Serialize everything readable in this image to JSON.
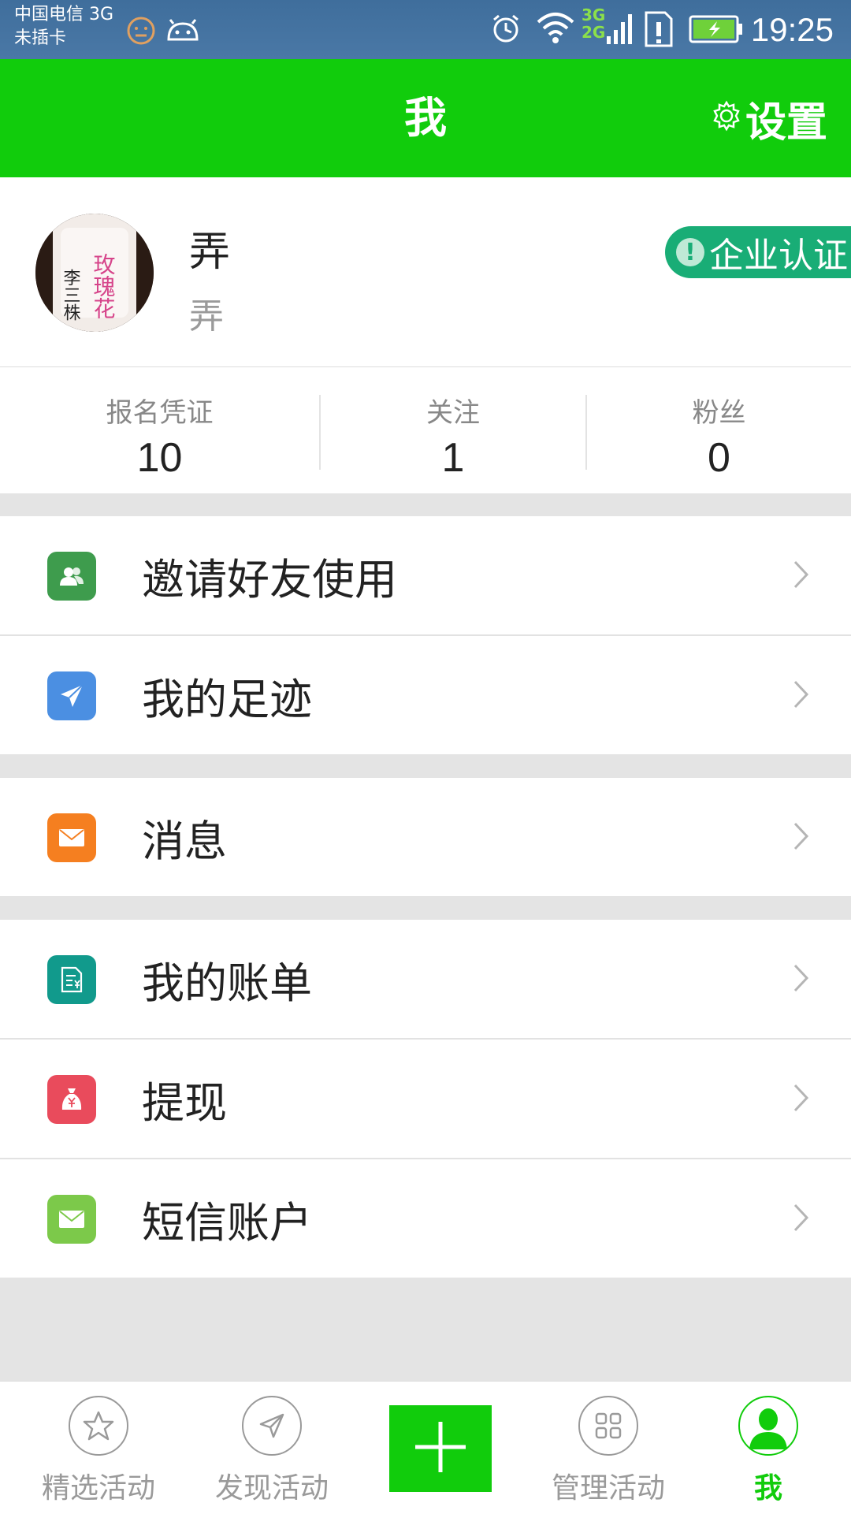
{
  "status_bar": {
    "carrier_line1": "中国电信 3G",
    "carrier_line2": "未插卡",
    "network_3g": "3G",
    "network_2g": "2G",
    "time": "19:25",
    "icons": [
      "smiley-icon",
      "android-icon",
      "alarm-icon",
      "wifi-icon",
      "signal-icon",
      "sim-alert-icon",
      "battery-charging-icon"
    ]
  },
  "header": {
    "title": "我",
    "settings_label": "设置",
    "background_color": "#11cc0c"
  },
  "profile": {
    "name": "弄",
    "nickname": "弄",
    "cert_badge": "企业认证",
    "avatar_text_left": "李三株",
    "avatar_text_right": "玫瑰花"
  },
  "stats": [
    {
      "label": "报名凭证",
      "value": "10"
    },
    {
      "label": "关注",
      "value": "1"
    },
    {
      "label": "粉丝",
      "value": "0"
    }
  ],
  "menu": [
    {
      "label": "邀请好友使用",
      "icon": "invite-friends-icon",
      "color": "#3e9c4d"
    },
    {
      "label": "我的足迹",
      "icon": "paper-plane-icon",
      "color": "#4b8fe2"
    },
    {
      "label": "消息",
      "icon": "envelope-icon",
      "color": "#f57f20"
    },
    {
      "label": "我的账单",
      "icon": "bill-icon",
      "color": "#119a8c"
    },
    {
      "label": "提现",
      "icon": "money-bag-icon",
      "color": "#e94b5c"
    },
    {
      "label": "短信账户",
      "icon": "sms-envelope-icon",
      "color": "#7cc94a"
    }
  ],
  "bottom_nav": {
    "tabs": [
      {
        "label": "精选活动",
        "icon": "star-icon"
      },
      {
        "label": "发现活动",
        "icon": "navigation-arrow-icon"
      },
      {
        "label": "管理活动",
        "icon": "grid-icon"
      },
      {
        "label": "我",
        "icon": "user-icon",
        "active": true
      }
    ],
    "active_color": "#11cc0c",
    "inactive_color": "#9a9a9a"
  }
}
